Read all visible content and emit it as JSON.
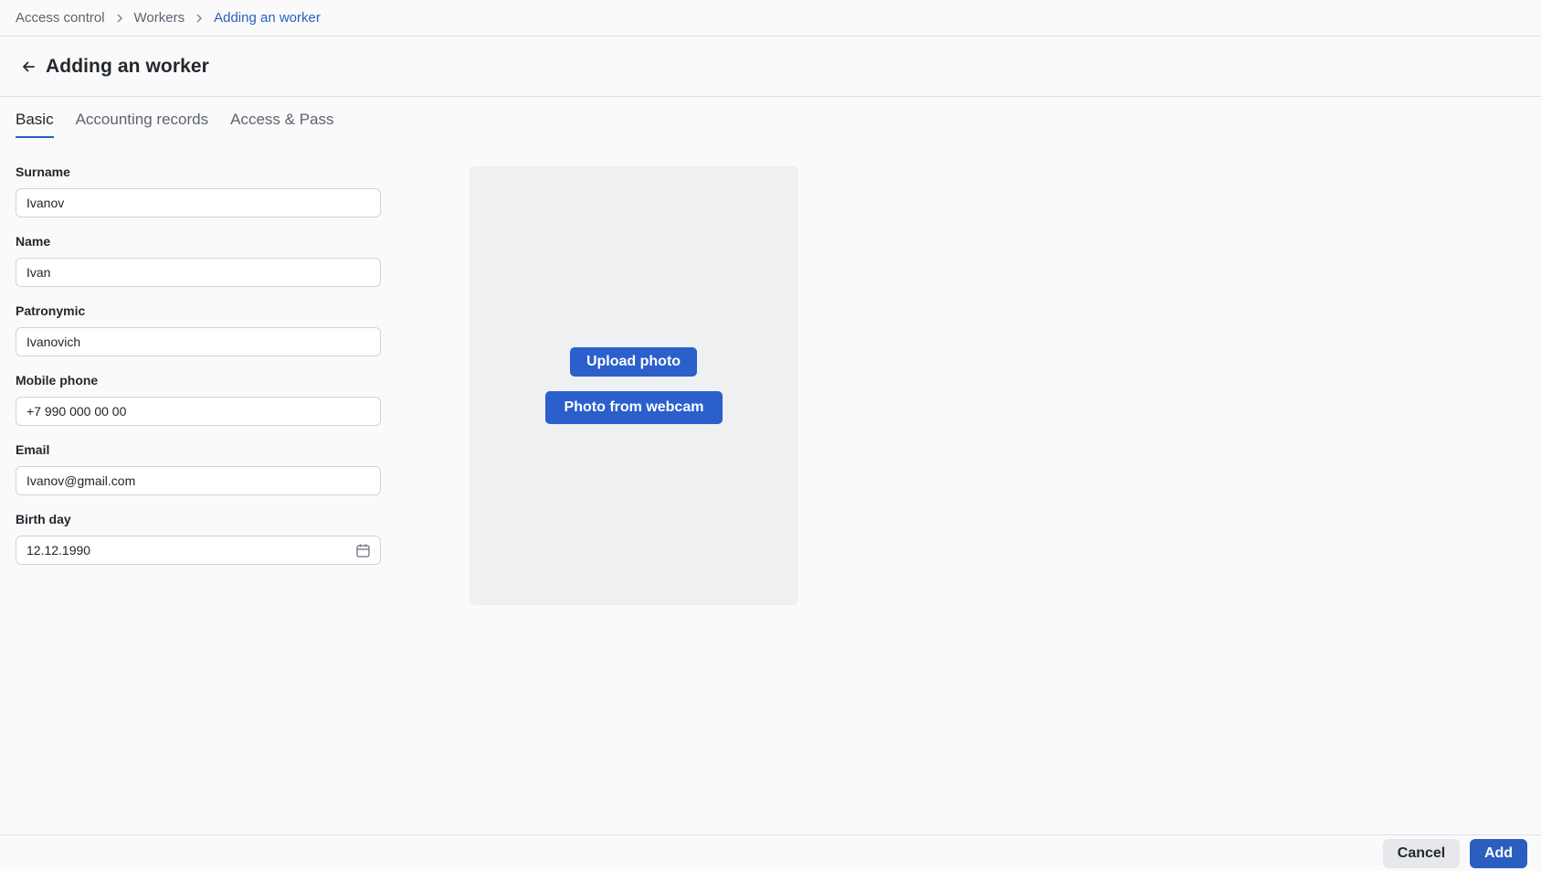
{
  "breadcrumb": {
    "items": [
      "Access control",
      "Workers",
      "Adding an worker"
    ]
  },
  "header": {
    "title": "Adding an worker",
    "back_icon": "arrow-left-icon"
  },
  "tabs": [
    {
      "label": "Basic",
      "active": true
    },
    {
      "label": "Accounting records",
      "active": false
    },
    {
      "label": "Access & Pass",
      "active": false
    }
  ],
  "form": {
    "surname": {
      "label": "Surname",
      "value": "Ivanov"
    },
    "name": {
      "label": "Name",
      "value": "Ivan"
    },
    "patronymic": {
      "label": "Patronymic",
      "value": "Ivanovich"
    },
    "mobile_phone": {
      "label": "Mobile phone",
      "value": "+7 990 000 00 00"
    },
    "email": {
      "label": "Email",
      "value": "Ivanov@gmail.com"
    },
    "birth_day": {
      "label": "Birth day",
      "value": "12.12.1990",
      "icon": "calendar-icon"
    }
  },
  "photo": {
    "upload_label": "Upload photo",
    "webcam_label": "Photo from webcam"
  },
  "footer": {
    "cancel_label": "Cancel",
    "add_label": "Add"
  },
  "colors": {
    "accent": "#2a5fbf",
    "button_primary": "#2a5fcc",
    "photo_bg": "#eff0f2"
  }
}
